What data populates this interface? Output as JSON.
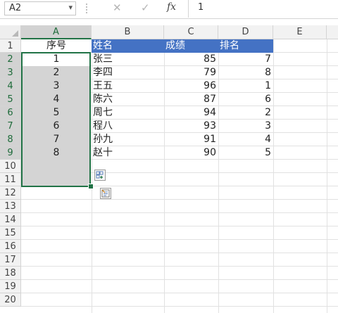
{
  "formula_bar": {
    "name_box": "A2",
    "name_box_arrow": "▾",
    "cancel_symbol": "✕",
    "enter_symbol": "✓",
    "fx_label": "fx",
    "formula_value": "1"
  },
  "columns": [
    "A",
    "B",
    "C",
    "D",
    "E"
  ],
  "rows": [
    "1",
    "2",
    "3",
    "4",
    "5",
    "6",
    "7",
    "8",
    "9",
    "10",
    "11",
    "12",
    "13",
    "14",
    "15",
    "16",
    "17",
    "18",
    "19",
    "20"
  ],
  "table": {
    "headers": {
      "a": "序号",
      "b": "姓名",
      "c": "成绩",
      "d": "排名"
    },
    "records": [
      {
        "seq": "1",
        "name": "张三",
        "score": "85",
        "rank": "7"
      },
      {
        "seq": "2",
        "name": "李四",
        "score": "79",
        "rank": "8"
      },
      {
        "seq": "3",
        "name": "王五",
        "score": "96",
        "rank": "1"
      },
      {
        "seq": "4",
        "name": "陈六",
        "score": "87",
        "rank": "6"
      },
      {
        "seq": "5",
        "name": "周七",
        "score": "94",
        "rank": "2"
      },
      {
        "seq": "6",
        "name": "程八",
        "score": "93",
        "rank": "3"
      },
      {
        "seq": "7",
        "name": "孙九",
        "score": "91",
        "rank": "4"
      },
      {
        "seq": "8",
        "name": "赵十",
        "score": "90",
        "rank": "5"
      }
    ]
  },
  "icons": {
    "autofill_options": "autofill-options-icon",
    "quick_analysis": "quick-analysis-icon"
  },
  "colors": {
    "header_fill": "#4472c4",
    "selection_border": "#217346",
    "selection_fill": "#d4d4d4"
  }
}
